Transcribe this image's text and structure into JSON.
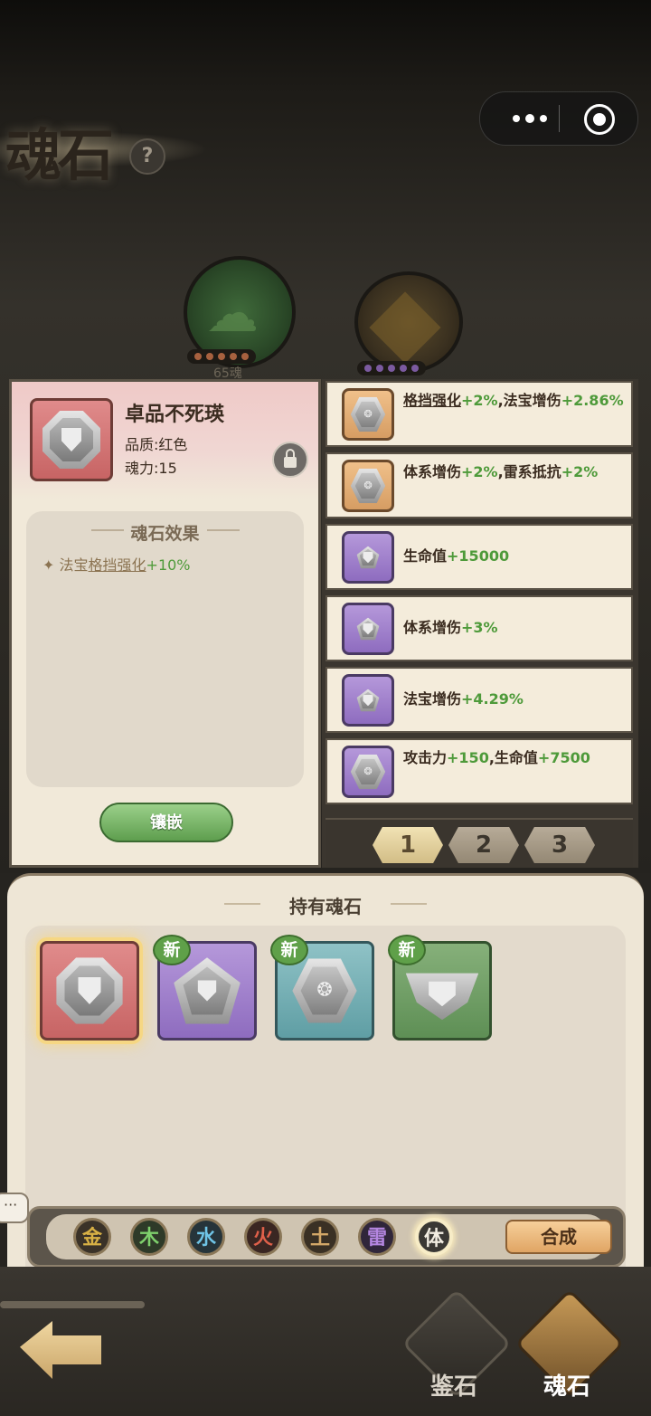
{
  "title": "魂石",
  "help_icon": "?",
  "background_nodes": {
    "green_pips": 5,
    "gold_pips": 5,
    "green_label": "65魂"
  },
  "detail": {
    "name": "卓品不死瑛",
    "quality": "品质:红色",
    "power": "魂力:15",
    "effect_title": "魂石效果",
    "effect_prefix": "法宝",
    "effect_underlined": "格挡强化",
    "effect_value": "+10%",
    "inlay_button": "镶嵌"
  },
  "stone_list": [
    {
      "tile": "orange",
      "shape": "hexa",
      "parts": [
        {
          "text": "格挡强化",
          "style": "u"
        },
        {
          "text": "+2%",
          "style": "g"
        },
        {
          "text": ",法宝增伤",
          "style": ""
        },
        {
          "text": "+2.86%",
          "style": "g"
        }
      ]
    },
    {
      "tile": "orange",
      "shape": "hexa",
      "parts": [
        {
          "text": "体系增伤",
          "style": ""
        },
        {
          "text": "+2%",
          "style": "g"
        },
        {
          "text": ",雷系抵抗",
          "style": ""
        },
        {
          "text": "+2%",
          "style": "g"
        }
      ]
    },
    {
      "tile": "purple",
      "shape": "pent",
      "parts": [
        {
          "text": "生命值",
          "style": ""
        },
        {
          "text": "+15000",
          "style": "g"
        }
      ]
    },
    {
      "tile": "purple",
      "shape": "pent",
      "parts": [
        {
          "text": "体系增伤",
          "style": ""
        },
        {
          "text": "+3%",
          "style": "g"
        }
      ]
    },
    {
      "tile": "purple",
      "shape": "pent",
      "parts": [
        {
          "text": "法宝增伤",
          "style": ""
        },
        {
          "text": "+4.29%",
          "style": "g"
        }
      ]
    },
    {
      "tile": "purple",
      "shape": "hexa",
      "parts": [
        {
          "text": "攻击力",
          "style": ""
        },
        {
          "text": "+150",
          "style": "g"
        },
        {
          "text": ",生命值",
          "style": ""
        },
        {
          "text": "+7500",
          "style": "g"
        }
      ]
    }
  ],
  "pager": {
    "pages": [
      "1",
      "2",
      "3"
    ],
    "active": "1"
  },
  "owned": {
    "title": "持有魂石",
    "new_badge": "新",
    "stones": [
      {
        "tile": "red",
        "shape": "octa",
        "selected": true,
        "new": false
      },
      {
        "tile": "purple",
        "shape": "pent",
        "selected": false,
        "new": true
      },
      {
        "tile": "blue",
        "shape": "hexa",
        "selected": false,
        "new": true
      },
      {
        "tile": "green",
        "shape": "trap",
        "selected": false,
        "new": true
      }
    ]
  },
  "filters": {
    "elements": [
      {
        "label": "金",
        "color": "#d8b145",
        "bg": "#3a3228"
      },
      {
        "label": "木",
        "color": "#7ed06c",
        "bg": "#2e3a28"
      },
      {
        "label": "水",
        "color": "#6fc4e6",
        "bg": "#26343a"
      },
      {
        "label": "火",
        "color": "#e0604a",
        "bg": "#3a2622"
      },
      {
        "label": "土",
        "color": "#d4a868",
        "bg": "#3a3024"
      },
      {
        "label": "雷",
        "color": "#b486e0",
        "bg": "#30263a"
      },
      {
        "label": "体",
        "color": "#f2ede2",
        "bg": "#3a3834"
      }
    ],
    "active": "体",
    "compose_button": "合成"
  },
  "bottom_tabs": {
    "identify": "鉴石",
    "soulstone": "魂石"
  },
  "colors": {
    "accent_green": "#4e9a3a",
    "text_dark": "#3b2c20"
  }
}
